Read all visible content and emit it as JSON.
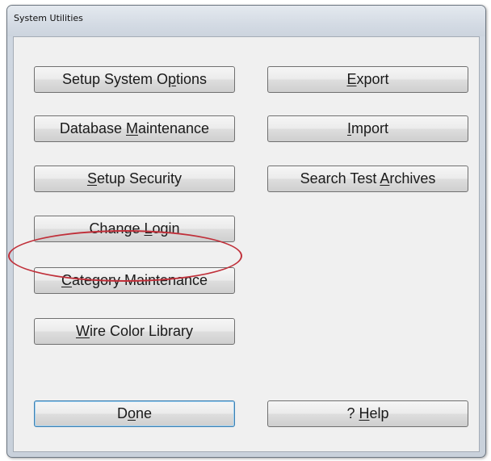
{
  "window": {
    "title": "System Utilities"
  },
  "buttons": {
    "setup_system_options": {
      "before": "Setup System O",
      "key": "p",
      "after": "tions"
    },
    "database_maintenance": {
      "before": "Database ",
      "key": "M",
      "after": "aintenance"
    },
    "setup_security": {
      "before": "",
      "key": "S",
      "after": "etup Security"
    },
    "change_login": {
      "before": "Change ",
      "key": "L",
      "after": "ogin"
    },
    "category_maintenance": {
      "before": "",
      "key": "C",
      "after": "ategory Maintenance"
    },
    "wire_color_library": {
      "before": "",
      "key": "W",
      "after": "ire Color Library"
    },
    "export": {
      "before": "",
      "key": "E",
      "after": "xport"
    },
    "import": {
      "before": "",
      "key": "I",
      "after": "mport"
    },
    "search_test_archives": {
      "before": "Search Test ",
      "key": "A",
      "after": "rchives"
    },
    "done": {
      "before": "D",
      "key": "o",
      "after": "ne"
    },
    "help": {
      "before": "? ",
      "key": "H",
      "after": "elp"
    }
  },
  "annotation": {
    "highlight_color": "#c0303a"
  }
}
